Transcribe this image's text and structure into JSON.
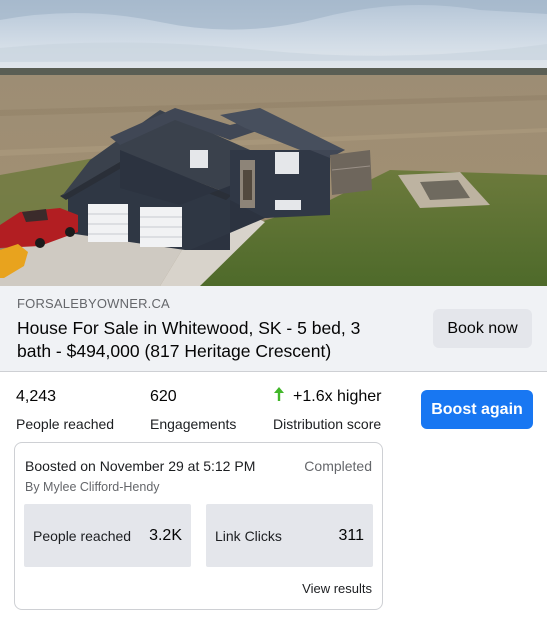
{
  "link_preview": {
    "domain": "FORSALEBYOWNER.CA",
    "title": "House For Sale in Whitewood, SK - 5 bed, 3 bath - $494,000 (817 Heritage Crescent)",
    "cta_label": "Book now"
  },
  "metrics": [
    {
      "value": "4,243",
      "label": "People reached"
    },
    {
      "value": "620",
      "label": "Engagements"
    },
    {
      "value": "+1.6x higher",
      "label": "Distribution score",
      "icon": "up-arrow-icon",
      "icon_color": "#42b72a"
    }
  ],
  "boost_again_label": "Boost again",
  "boost_card": {
    "date_text": "Boosted on November 29 at 5:12 PM",
    "status": "Completed",
    "author": "By Mylee Clifford-Hendy",
    "stats": [
      {
        "label": "People reached",
        "value": "3.2K"
      },
      {
        "label": "Link Clicks",
        "value": "311"
      }
    ],
    "view_results_label": "View results"
  },
  "colors": {
    "primary": "#1877f2",
    "secondary_button": "#e4e6eb",
    "strip_background": "#f0f2f5",
    "positive": "#42b72a"
  }
}
